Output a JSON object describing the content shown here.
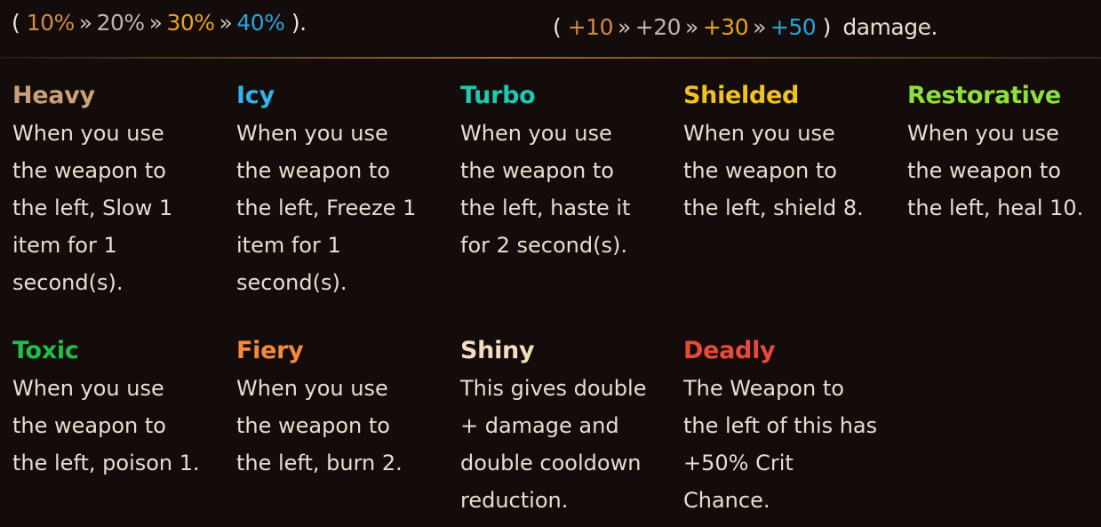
{
  "tier_left": {
    "open": "(",
    "values": [
      "10%",
      "20%",
      "30%",
      "40%"
    ],
    "separator": "»",
    "close": ")."
  },
  "tier_right": {
    "open": "(",
    "values": [
      "+10",
      "+20",
      "+30",
      "+50"
    ],
    "separator": "»",
    "close": ")",
    "suffix": "damage."
  },
  "colors": {
    "tier1": "#d08a4a",
    "tier2": "#bdb6ae",
    "tier3": "#e8a21a",
    "tier4": "#2aa3dd"
  },
  "enchantments": [
    {
      "name": "Heavy",
      "color": "#c9a07a",
      "lines": [
        "When you use",
        "the weapon to",
        "the left, Slow 1",
        "item for 1",
        "second(s)."
      ]
    },
    {
      "name": "Icy",
      "color": "#33b3ee",
      "lines": [
        "When you use",
        "the weapon to",
        "the left, Freeze 1",
        "item for 1",
        "second(s)."
      ]
    },
    {
      "name": "Turbo",
      "color": "#1ec9b0",
      "lines": [
        "When you use",
        "the weapon to",
        "the left, haste it",
        "for 2 second(s)."
      ]
    },
    {
      "name": "Shielded",
      "color": "#f2c21d",
      "lines": [
        "When you use",
        "the weapon to",
        "the left, shield 8."
      ]
    },
    {
      "name": "Restorative",
      "color": "#8ee03a",
      "lines": [
        "When you use",
        "the weapon to",
        "the left, heal 10."
      ]
    },
    {
      "name": "Toxic",
      "color": "#1fbf4a",
      "lines": [
        "When you use",
        "the weapon to",
        "the left, poison 1."
      ]
    },
    {
      "name": "Fiery",
      "color": "#f58a3c",
      "lines": [
        "When you use",
        "the weapon to",
        "the left, burn 2."
      ]
    },
    {
      "name": "Shiny",
      "color": "#f4dcc0",
      "lines": [
        "This gives double",
        "+ damage and",
        "double cooldown",
        "reduction."
      ]
    },
    {
      "name": "Deadly",
      "color": "#e84a3a",
      "lines": [
        "The Weapon to",
        "the left of this has",
        "+50% Crit",
        "Chance."
      ]
    }
  ]
}
